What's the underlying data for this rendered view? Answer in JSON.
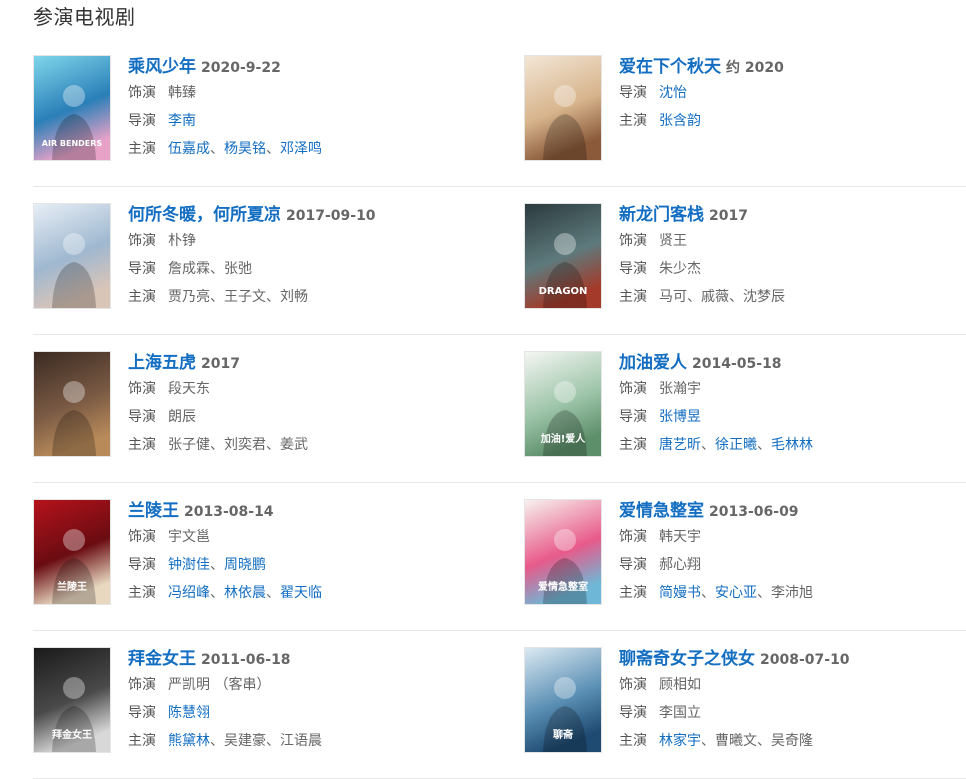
{
  "section_title": "参演电视剧",
  "dramas": [
    {
      "title": "乘风少年",
      "date": "2020-9-22",
      "role_label": "饰演",
      "role": "韩臻",
      "director_label": "导演",
      "directors": [
        {
          "name": "李南",
          "link": true
        }
      ],
      "cast_label": "主演",
      "cast": [
        {
          "name": "伍嘉成",
          "link": true
        },
        {
          "name": "杨昊铭",
          "link": true
        },
        {
          "name": "邓泽鸣",
          "link": true
        }
      ],
      "poster_text": "AIR BENDERS",
      "poster_colors": [
        "#7fd6ea",
        "#2a7fb8",
        "#e8a2c8"
      ]
    },
    {
      "title": "爱在下个秋天",
      "date": "约 2020",
      "role_label": "",
      "role": "",
      "director_label": "导演",
      "directors": [
        {
          "name": "沈怡",
          "link": true
        }
      ],
      "cast_label": "主演",
      "cast": [
        {
          "name": "张含韵",
          "link": true
        }
      ],
      "poster_text": "",
      "poster_colors": [
        "#f3e6d6",
        "#d7b48c",
        "#8a5a3a"
      ]
    },
    {
      "title": "何所冬暖，何所夏凉",
      "date": "2017-09-10",
      "role_label": "饰演",
      "role": "朴铮",
      "director_label": "导演",
      "directors": [
        {
          "name": "詹成霖",
          "link": false
        },
        {
          "name": "张弛",
          "link": false
        }
      ],
      "cast_label": "主演",
      "cast": [
        {
          "name": "贾乃亮",
          "link": false
        },
        {
          "name": "王子文",
          "link": false
        },
        {
          "name": "刘畅",
          "link": false
        }
      ],
      "poster_text": "",
      "poster_colors": [
        "#e7eef6",
        "#9fb8d0",
        "#d9c4b8"
      ]
    },
    {
      "title": "新龙门客栈",
      "date": "2017",
      "role_label": "饰演",
      "role": "贤王",
      "director_label": "导演",
      "directors": [
        {
          "name": "朱少杰",
          "link": false
        }
      ],
      "cast_label": "主演",
      "cast": [
        {
          "name": "马可",
          "link": false
        },
        {
          "name": "戚薇",
          "link": false
        },
        {
          "name": "沈梦辰",
          "link": false
        }
      ],
      "poster_text": "DRAGON",
      "poster_colors": [
        "#2b3a3e",
        "#5e7a7c",
        "#a33a2a"
      ]
    },
    {
      "title": "上海五虎",
      "date": "2017",
      "role_label": "饰演",
      "role": "段天东",
      "director_label": "导演",
      "directors": [
        {
          "name": "朗辰",
          "link": false
        }
      ],
      "cast_label": "主演",
      "cast": [
        {
          "name": "张子健",
          "link": false
        },
        {
          "name": "刘奕君",
          "link": false
        },
        {
          "name": "姜武",
          "link": false
        }
      ],
      "poster_text": "",
      "poster_colors": [
        "#3a2a22",
        "#7a5a44",
        "#b88a5a"
      ]
    },
    {
      "title": "加油爱人",
      "date": "2014-05-18",
      "role_label": "饰演",
      "role": "张瀚宇",
      "director_label": "导演",
      "directors": [
        {
          "name": "张博昱",
          "link": true
        }
      ],
      "cast_label": "主演",
      "cast": [
        {
          "name": "唐艺昕",
          "link": true
        },
        {
          "name": "徐正曦",
          "link": true
        },
        {
          "name": "毛林林",
          "link": true
        }
      ],
      "poster_text": "加油!爱人",
      "poster_colors": [
        "#f4f6f2",
        "#9cc4a8",
        "#5d8f6a"
      ]
    },
    {
      "title": "兰陵王",
      "date": "2013-08-14",
      "role_label": "饰演",
      "role": "宇文邕",
      "director_label": "导演",
      "directors": [
        {
          "name": "钟澍佳",
          "link": true
        },
        {
          "name": "周晓鹏",
          "link": true
        }
      ],
      "cast_label": "主演",
      "cast": [
        {
          "name": "冯绍峰",
          "link": true
        },
        {
          "name": "林依晨",
          "link": true
        },
        {
          "name": "翟天临",
          "link": true
        }
      ],
      "poster_text": "兰陵王",
      "poster_colors": [
        "#b5121b",
        "#6a0c12",
        "#e8d8c0"
      ]
    },
    {
      "title": "爱情急整室",
      "date": "2013-06-09",
      "role_label": "饰演",
      "role": "韩天宇",
      "director_label": "导演",
      "directors": [
        {
          "name": "郝心翔",
          "link": false
        }
      ],
      "cast_label": "主演",
      "cast": [
        {
          "name": "简嫚书",
          "link": true
        },
        {
          "name": "安心亚",
          "link": true
        },
        {
          "name": "李沛旭",
          "link": false
        }
      ],
      "poster_text": "爱情急整室",
      "poster_colors": [
        "#f7f2ee",
        "#e85a8a",
        "#6fb7d6"
      ]
    },
    {
      "title": "拜金女王",
      "date": "2011-06-18",
      "role_label": "饰演",
      "role": "严凯明 （客串）",
      "director_label": "导演",
      "directors": [
        {
          "name": "陈慧翎",
          "link": true
        }
      ],
      "cast_label": "主演",
      "cast": [
        {
          "name": "熊黛林",
          "link": true
        },
        {
          "name": "吴建豪",
          "link": false
        },
        {
          "name": "江语晨",
          "link": false
        }
      ],
      "poster_text": "拜金女王",
      "poster_colors": [
        "#1a1a1a",
        "#4a4a4a",
        "#d8d8d8"
      ]
    },
    {
      "title": "聊斋奇女子之侠女",
      "date": "2008-07-10",
      "role_label": "饰演",
      "role": "顾相如",
      "director_label": "导演",
      "directors": [
        {
          "name": "李国立",
          "link": false
        }
      ],
      "cast_label": "主演",
      "cast": [
        {
          "name": "林家宇",
          "link": true
        },
        {
          "name": "曹曦文",
          "link": false
        },
        {
          "name": "吴奇隆",
          "link": false
        }
      ],
      "poster_text": "聊斋",
      "poster_colors": [
        "#dbe9f2",
        "#5a8fb4",
        "#1f4b73"
      ]
    }
  ]
}
